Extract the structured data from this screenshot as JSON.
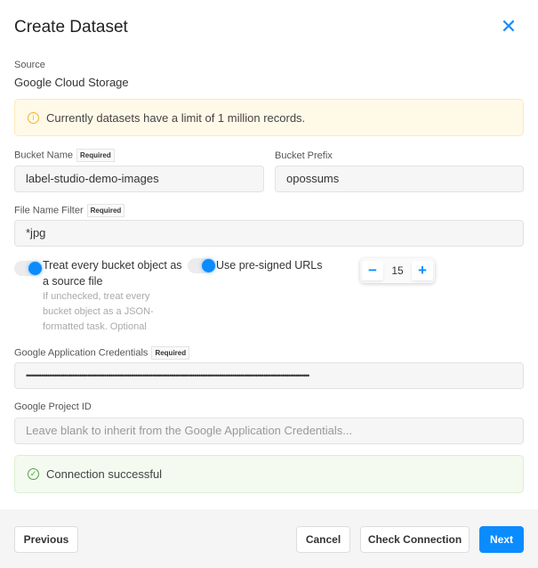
{
  "title": "Create Dataset",
  "source": {
    "label": "Source",
    "value": "Google Cloud Storage"
  },
  "limit_notice": "Currently datasets have a limit of 1 million records.",
  "required_badge": "Required",
  "bucket_name": {
    "label": "Bucket Name",
    "value": "label-studio-demo-images"
  },
  "bucket_prefix": {
    "label": "Bucket Prefix",
    "value": "opossums"
  },
  "file_filter": {
    "label": "File Name Filter",
    "value": "*jpg"
  },
  "treat_source": {
    "label": "Treat every bucket object as a source file",
    "help": "If unchecked, treat every bucket object as a JSON-formatted task. Optional",
    "checked": true
  },
  "presigned": {
    "label": "Use pre-signed URLs",
    "checked": true
  },
  "stepper": {
    "value": "15",
    "minus": "−",
    "plus": "+"
  },
  "credentials": {
    "label": "Google Application Credentials",
    "value": "••••••••••••••••••••••••••••••••••••••••••••••••••••••••••••••••••••••••••••••••••••••••••••••••••••••••••••••••••••••••••••••••••••••••••••••••••••"
  },
  "project_id": {
    "label": "Google Project ID",
    "placeholder": "Leave blank to inherit from the Google Application Credentials..."
  },
  "connection_status": "Connection successful",
  "buttons": {
    "previous": "Previous",
    "cancel": "Cancel",
    "check": "Check Connection",
    "next": "Next"
  },
  "colors": {
    "accent": "#0a8cff",
    "warning_bg": "#fff9e8",
    "success": "#52a43a"
  }
}
